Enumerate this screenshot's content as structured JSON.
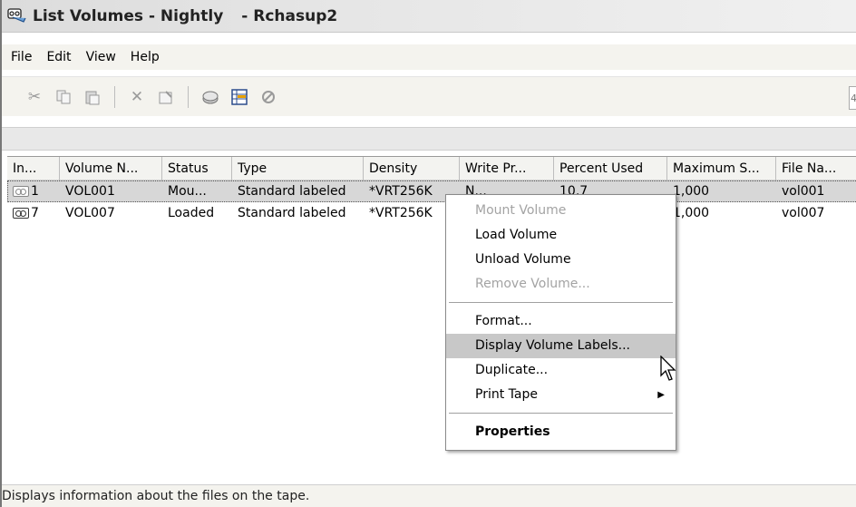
{
  "window": {
    "title": "List Volumes - Nightly",
    "subtitle": "- Rchasup2"
  },
  "menubar": [
    "File",
    "Edit",
    "View",
    "Help"
  ],
  "toolbar": {
    "icons": [
      "cut-icon",
      "copy-icon",
      "paste-icon",
      "delete-icon",
      "properties-icon",
      "tape-drive-icon",
      "grid-view-icon",
      "stop-icon"
    ],
    "right_partial": "4"
  },
  "table": {
    "columns": [
      "In...",
      "Volume N...",
      "Status",
      "Type",
      "Density",
      "Write Pr...",
      "Percent Used",
      "Maximum S...",
      "File Na..."
    ],
    "rows": [
      {
        "index": "1",
        "volume": "VOL001",
        "status": "Mou...",
        "type": "Standard labeled",
        "density": "*VRT256K",
        "write": "N...",
        "percent": "10.7",
        "max": "1,000",
        "file": "vol001"
      },
      {
        "index": "7",
        "volume": "VOL007",
        "status": "Loaded",
        "type": "Standard labeled",
        "density": "*VRT256K",
        "write": "",
        "percent": "",
        "max": "1,000",
        "file": "vol007"
      }
    ]
  },
  "context_menu": {
    "items": [
      {
        "label": "Mount Volume",
        "state": "disabled"
      },
      {
        "label": "Load Volume",
        "state": "enabled"
      },
      {
        "label": "Unload Volume",
        "state": "enabled"
      },
      {
        "label": "Remove Volume...",
        "state": "disabled"
      },
      {
        "label": "Format...",
        "state": "enabled"
      },
      {
        "label": "Display Volume Labels...",
        "state": "highlighted"
      },
      {
        "label": "Duplicate...",
        "state": "enabled"
      },
      {
        "label": "Print Tape",
        "state": "submenu"
      },
      {
        "label": "Properties",
        "state": "default"
      }
    ]
  },
  "statusbar": {
    "text": "Displays information about the files on the tape."
  }
}
